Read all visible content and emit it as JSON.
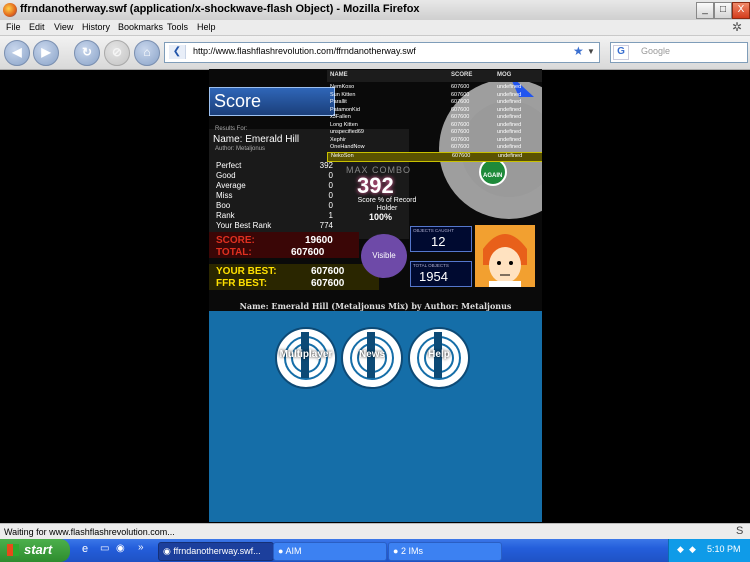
{
  "window": {
    "title": "ffrndanotherway.swf (application/x-shockwave-flash Object) - Mozilla Firefox",
    "controls": [
      "_",
      "□",
      "X"
    ]
  },
  "menu": [
    "File",
    "Edit",
    "View",
    "History",
    "Bookmarks",
    "Tools",
    "Help"
  ],
  "nav": {
    "back": "◀",
    "forward": "▶",
    "reload": "↻",
    "stop": "⊘",
    "home": "⌂",
    "url": "http://www.flashflashrevolution.com/ffrndanotherway.swf",
    "search_placeholder": "Google"
  },
  "flash": {
    "leaderboard": {
      "headers": [
        "NAME",
        "SCORE",
        "MOG"
      ],
      "rows": [
        {
          "name": "NemKoso",
          "score": "607600",
          "mod": "undefined"
        },
        {
          "name": "Sun Kitten",
          "score": "607600",
          "mod": "undefined"
        },
        {
          "name": "Parallit",
          "score": "607600",
          "mod": "undefined"
        },
        {
          "name": "PatamonKid",
          "score": "607600",
          "mod": "undefined"
        },
        {
          "name": "x3Fallen",
          "score": "607600",
          "mod": "undefined"
        },
        {
          "name": "Long Kitten",
          "score": "607600",
          "mod": "undefined"
        },
        {
          "name": "unspecified69",
          "score": "607600",
          "mod": "undefined"
        },
        {
          "name": "Xephir",
          "score": "607600",
          "mod": "undefined"
        },
        {
          "name": "OneHandNow",
          "score": "607600",
          "mod": "undefined"
        },
        {
          "name": "NekoSon",
          "score": "607600",
          "mod": "undefined"
        }
      ]
    },
    "score_title": "Score",
    "results_for": "Results For:",
    "song_name": "Name: Emerald Hill",
    "author_small": "Author: Metaljonus",
    "stats": [
      {
        "label": "Perfect",
        "value": "392"
      },
      {
        "label": "Good",
        "value": "0"
      },
      {
        "label": "Average",
        "value": "0"
      },
      {
        "label": "Miss",
        "value": "0"
      },
      {
        "label": "Boo",
        "value": "0"
      },
      {
        "label": "Rank",
        "value": "1"
      },
      {
        "label": "Your Best Rank",
        "value": "774"
      }
    ],
    "max_combo_label": "MAX COMBO",
    "max_combo": "392",
    "score_pct_label": "Score % of Record Holder",
    "score_pct": "100%",
    "score_label": "SCORE:",
    "score_value": "19600",
    "total_label": "TOTAL:",
    "total_value": "607600",
    "your_best_label": "YOUR BEST:",
    "your_best_value": "607600",
    "ffr_best_label": "FFR BEST:",
    "ffr_best_value": "607600",
    "visible_button": "Visible",
    "objects_caught_label": "OBJECTS CAUGHT",
    "objects_caught": "12",
    "total_objects_label": "TOTAL OBJECTS",
    "total_objects": "1954",
    "again_label": "AGAIN",
    "song_footer": "Name: Emerald Hill (Metaljonus Mix) by Author: Metaljonus",
    "buttons": [
      "Multiplayer",
      "News",
      "Help"
    ]
  },
  "status": {
    "text": "Waiting for www.flashflashrevolution.com..."
  },
  "taskbar": {
    "start": "start",
    "tasks": [
      "ffrndanotherway.swf...",
      "AIM",
      "2 IMs"
    ],
    "time": "5:10 PM"
  },
  "colors": {
    "flash_blue": "#156ea8",
    "score_red": "#e03020",
    "best_yellow": "#ffe000"
  }
}
